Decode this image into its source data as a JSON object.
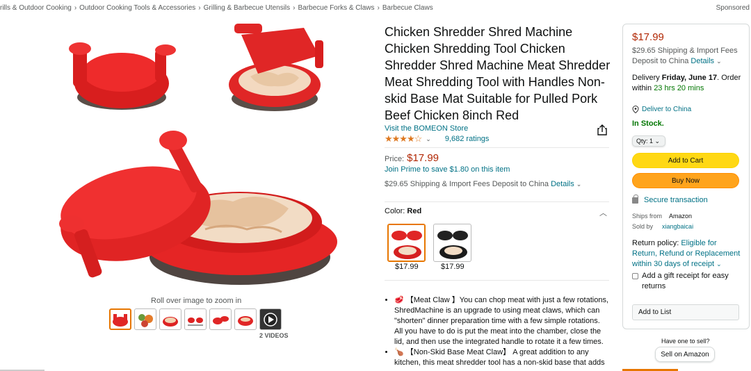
{
  "breadcrumb": [
    "rills & Outdoor Cooking",
    "Outdoor Cooking Tools & Accessories",
    "Grilling & Barbecue Utensils",
    "Barbecue Forks & Claws",
    "Barbecue Claws"
  ],
  "breadcrumb_sep": "›",
  "sponsored": "Sponsored",
  "gallery": {
    "roll_over": "Roll over image to zoom in",
    "videos_label": "2 VIDEOS"
  },
  "product": {
    "title": "Chicken Shredder Shred Machine Chicken Shredding Tool Chicken Shredder Shred Machine Meat Shredder Meat Shredding Tool with Handles Non-skid Base Mat Suitable for Pulled Pork Beef Chicken 8inch Red",
    "store_link": "Visit the BOMEON Store",
    "rating_stars": "★★★★☆",
    "ratings_count": "9,682 ratings",
    "price_label": "Price:",
    "price": "$17.99",
    "prime_text": "Join Prime to save $1.80 on this item",
    "shipping_text": "$29.65 Shipping & Import Fees Deposit to China",
    "details_link": "Details",
    "color_label": "Color:",
    "color_value": "Red",
    "swatches": [
      {
        "price": "$17.99",
        "color": "red"
      },
      {
        "price": "$17.99",
        "color": "black"
      }
    ],
    "bullets": [
      {
        "icon": "🥩",
        "text": "【Meat Claw 】You can chop meat with just a few rotations, ShredMachine is an upgrade to using meat claws, which can \"shorten\" dinner preparation time with a few simple rotations. All you have to do is put the meat into the chamber, close the lid, and then use the integrated handle to rotate it a few times."
      },
      {
        "icon": "🍗",
        "text": "【Non-Skid Base Meat Claw】 A great addition to any kitchen, this meat shredder tool has a non-skid base that adds"
      }
    ]
  },
  "buybox": {
    "price": "$17.99",
    "shipping": "$29.65 Shipping & Import Fees Deposit to China",
    "details_link": "Details",
    "delivery_prefix": "Delivery",
    "delivery_date": "Friday, June 17",
    "delivery_suffix": ". Order within",
    "delivery_window": "23 hrs 20 mins",
    "deliver_to": "Deliver to China",
    "stock": "In Stock.",
    "qty": "Qty: 1",
    "add_to_cart": "Add to Cart",
    "buy_now": "Buy Now",
    "secure": "Secure transaction",
    "ships_from_label": "Ships from",
    "ships_from_value": "Amazon",
    "sold_by_label": "Sold by",
    "sold_by_value": "xiangbaicai",
    "return_label": "Return policy:",
    "return_link": "Eligible for Return, Refund or Replacement within 30 days of receipt",
    "gift_receipt": "Add a gift receipt for easy returns",
    "add_to_list": "Add to List",
    "sell_question": "Have one to sell?",
    "sell_button": "Sell on Amazon"
  },
  "colors": {
    "link": "#007185",
    "price": "#b12704",
    "stock": "#007600",
    "cart_btn": "#ffd814",
    "buy_btn": "#ffa41c",
    "star": "#de7921"
  }
}
